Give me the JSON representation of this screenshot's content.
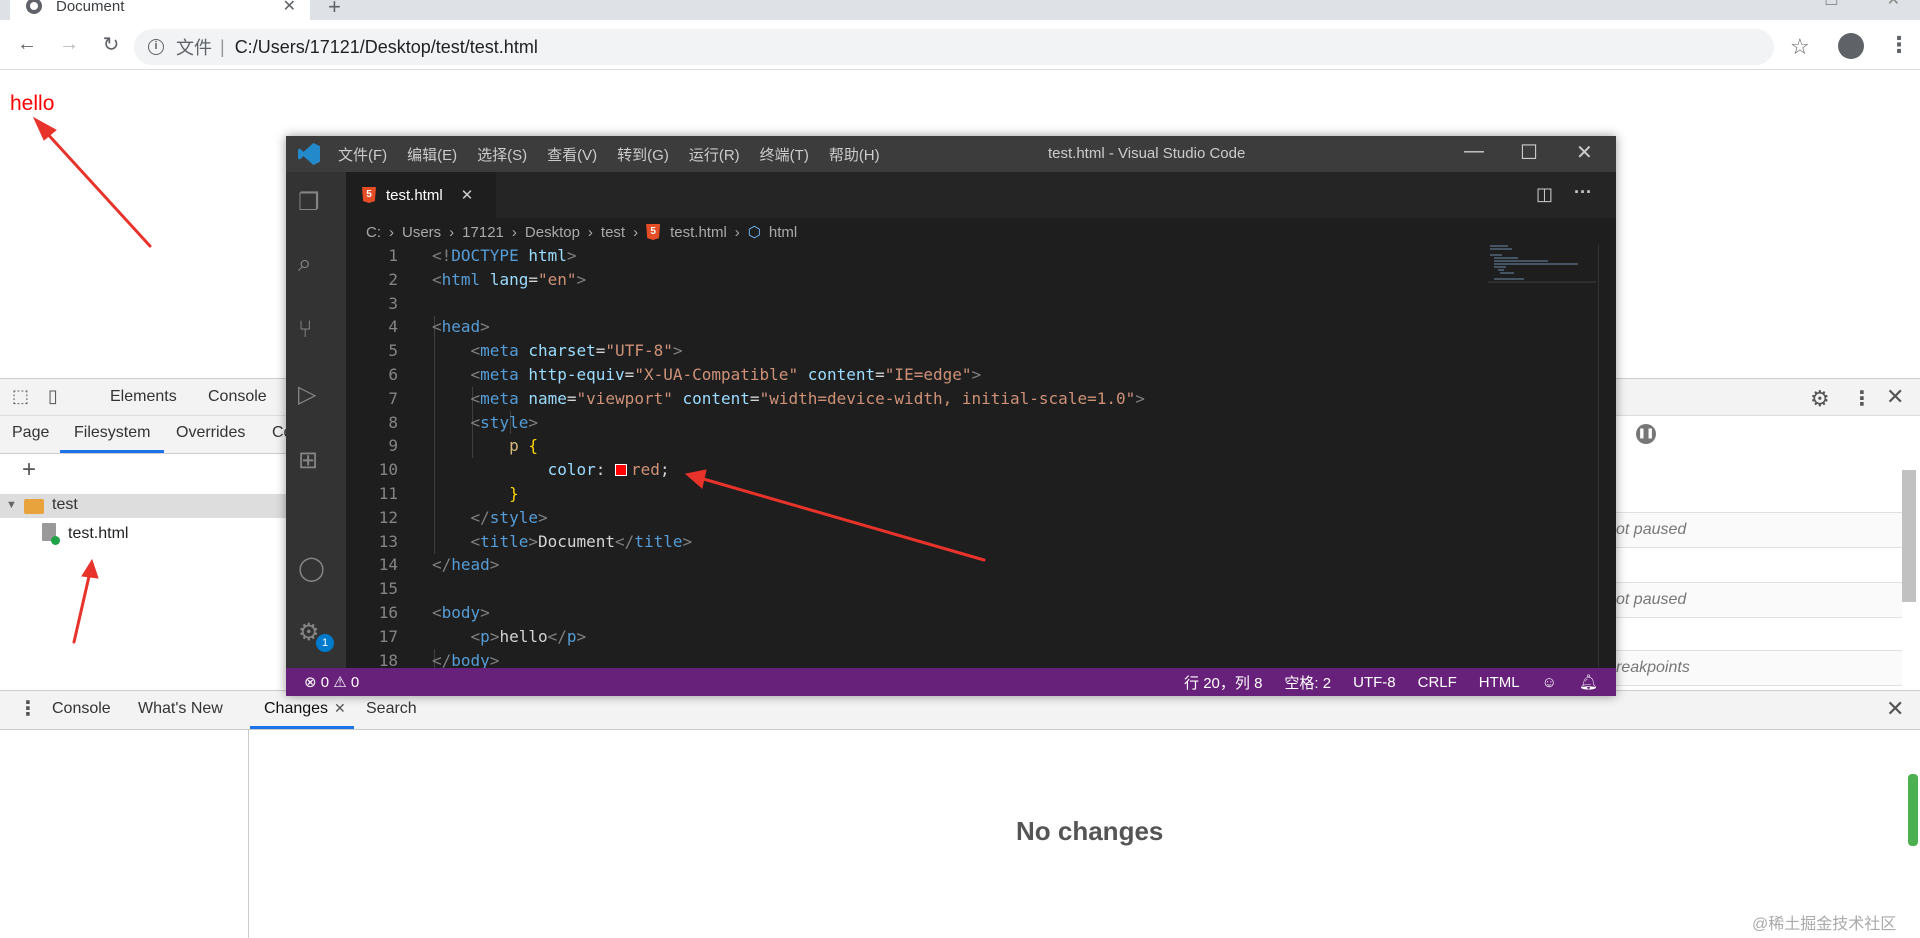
{
  "browser": {
    "tab_title": "Document",
    "address_label": "文件",
    "url": "C:/Users/17121/Desktop/test/test.html"
  },
  "page": {
    "hello": "hello"
  },
  "devtools": {
    "top_tabs": [
      "Elements",
      "Console"
    ],
    "sub_tabs": [
      "Page",
      "Filesystem",
      "Overrides",
      "Co"
    ],
    "folder": "test",
    "file": "test.html",
    "right_rows": [
      "ot paused",
      "ot paused",
      "reakpoints"
    ],
    "drawer_tabs": [
      "Console",
      "What's New",
      "Changes",
      "Search"
    ],
    "no_changes": "No changes",
    "watermark": "@稀土掘金技术社区"
  },
  "vscode": {
    "menu": [
      "文件(F)",
      "编辑(E)",
      "选择(S)",
      "查看(V)",
      "转到(G)",
      "运行(R)",
      "终端(T)",
      "帮助(H)"
    ],
    "window_title": "test.html - Visual Studio Code",
    "tab_label": "test.html",
    "breadcrumbs": [
      "C:",
      "Users",
      "17121",
      "Desktop",
      "test",
      "test.html",
      "html"
    ],
    "status_left": "⊗ 0 ⚠ 0",
    "status_right": [
      "行 20，列 8",
      "空格: 2",
      "UTF-8",
      "CRLF",
      "HTML"
    ],
    "badge": "1",
    "line_numbers": [
      "1",
      "2",
      "3",
      "4",
      "5",
      "6",
      "7",
      "8",
      "9",
      "10",
      "11",
      "12",
      "13",
      "14",
      "15",
      "16",
      "17",
      "18"
    ]
  },
  "colors": {
    "hello": "#ff0000",
    "statusbar": "#68217a",
    "editor_bg": "#1e1e1e"
  }
}
